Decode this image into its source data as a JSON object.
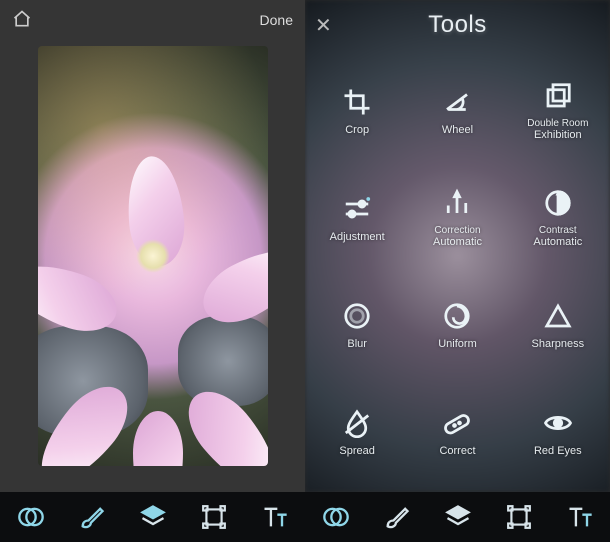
{
  "left": {
    "done_label": "Done"
  },
  "right": {
    "title": "Tools",
    "tools": [
      {
        "id": "crop",
        "label": "Crop"
      },
      {
        "id": "wheel",
        "label": "Wheel"
      },
      {
        "id": "dbl-exhibition",
        "label_top": "Double Room",
        "label": "Exhibition"
      },
      {
        "id": "adjustment",
        "label": "Adjustment"
      },
      {
        "id": "correction-auto",
        "label_top": "Correction",
        "label": "Automatic"
      },
      {
        "id": "contrast-auto",
        "label_top": "Contrast",
        "label": "Automatic"
      },
      {
        "id": "blur",
        "label": "Blur"
      },
      {
        "id": "uniform",
        "label": "Uniform"
      },
      {
        "id": "sharpness",
        "label": "Sharpness"
      },
      {
        "id": "spread",
        "label": "Spread"
      },
      {
        "id": "correct",
        "label": "Correct"
      },
      {
        "id": "red-eyes",
        "label": "Red Eyes"
      }
    ]
  },
  "bottom_bar": {
    "items": [
      "palette",
      "brush",
      "layers",
      "transform",
      "text"
    ],
    "selected_left": 0,
    "selected_right": 0
  },
  "colors": {
    "accent": "#8fd6e8",
    "panel_bg": "#353535",
    "bar_bg": "#0c0d0f"
  }
}
